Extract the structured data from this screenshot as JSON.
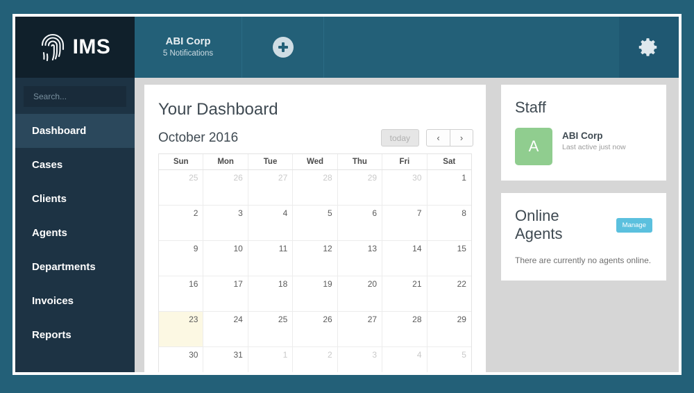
{
  "header": {
    "brand_name": "IMS",
    "brand_icon": "fingerprint-icon",
    "org_name": "ABI Corp",
    "notifications": "5 Notifications",
    "add_icon": "plus-icon",
    "settings_icon": "gear-icon"
  },
  "sidebar": {
    "search_placeholder": "Search...",
    "items": [
      {
        "label": "Dashboard",
        "active": true
      },
      {
        "label": "Cases",
        "active": false
      },
      {
        "label": "Clients",
        "active": false
      },
      {
        "label": "Agents",
        "active": false
      },
      {
        "label": "Departments",
        "active": false
      },
      {
        "label": "Invoices",
        "active": false
      },
      {
        "label": "Reports",
        "active": false
      }
    ]
  },
  "main": {
    "page_title": "Your Dashboard",
    "calendar": {
      "month_label": "October 2016",
      "today_button": "today",
      "prev_button": "‹",
      "next_button": "›",
      "weekdays": [
        "Sun",
        "Mon",
        "Tue",
        "Wed",
        "Thu",
        "Fri",
        "Sat"
      ],
      "today_date": 23,
      "weeks": [
        [
          {
            "d": "25",
            "other": true
          },
          {
            "d": "26",
            "other": true
          },
          {
            "d": "27",
            "other": true
          },
          {
            "d": "28",
            "other": true
          },
          {
            "d": "29",
            "other": true
          },
          {
            "d": "30",
            "other": true
          },
          {
            "d": "1",
            "other": false
          }
        ],
        [
          {
            "d": "2",
            "other": false
          },
          {
            "d": "3",
            "other": false
          },
          {
            "d": "4",
            "other": false
          },
          {
            "d": "5",
            "other": false
          },
          {
            "d": "6",
            "other": false
          },
          {
            "d": "7",
            "other": false
          },
          {
            "d": "8",
            "other": false
          }
        ],
        [
          {
            "d": "9",
            "other": false
          },
          {
            "d": "10",
            "other": false
          },
          {
            "d": "11",
            "other": false
          },
          {
            "d": "12",
            "other": false
          },
          {
            "d": "13",
            "other": false
          },
          {
            "d": "14",
            "other": false
          },
          {
            "d": "15",
            "other": false
          }
        ],
        [
          {
            "d": "16",
            "other": false
          },
          {
            "d": "17",
            "other": false
          },
          {
            "d": "18",
            "other": false
          },
          {
            "d": "19",
            "other": false
          },
          {
            "d": "20",
            "other": false
          },
          {
            "d": "21",
            "other": false
          },
          {
            "d": "22",
            "other": false
          }
        ],
        [
          {
            "d": "23",
            "other": false,
            "today": true
          },
          {
            "d": "24",
            "other": false
          },
          {
            "d": "25",
            "other": false
          },
          {
            "d": "26",
            "other": false
          },
          {
            "d": "27",
            "other": false
          },
          {
            "d": "28",
            "other": false
          },
          {
            "d": "29",
            "other": false
          }
        ],
        [
          {
            "d": "30",
            "other": false
          },
          {
            "d": "31",
            "other": false
          },
          {
            "d": "1",
            "other": true
          },
          {
            "d": "2",
            "other": true
          },
          {
            "d": "3",
            "other": true
          },
          {
            "d": "4",
            "other": true
          },
          {
            "d": "5",
            "other": true
          }
        ]
      ]
    }
  },
  "right": {
    "staff": {
      "title": "Staff",
      "avatar_letter": "A",
      "name": "ABI Corp",
      "status": "Last active just now"
    },
    "online_agents": {
      "title": "Online Agents",
      "manage_button": "Manage",
      "empty_message": "There are currently no agents online."
    }
  },
  "colors": {
    "page_background": "#236078",
    "brand_background": "#10202b",
    "header_background": "#236078",
    "sidebar_background": "#1d3344",
    "sidebar_active": "#2b485c",
    "content_background": "#d6d6d6",
    "accent_manage": "#5bc0de",
    "avatar_green": "#90cd8f",
    "today_highlight": "#fcf8e3"
  }
}
